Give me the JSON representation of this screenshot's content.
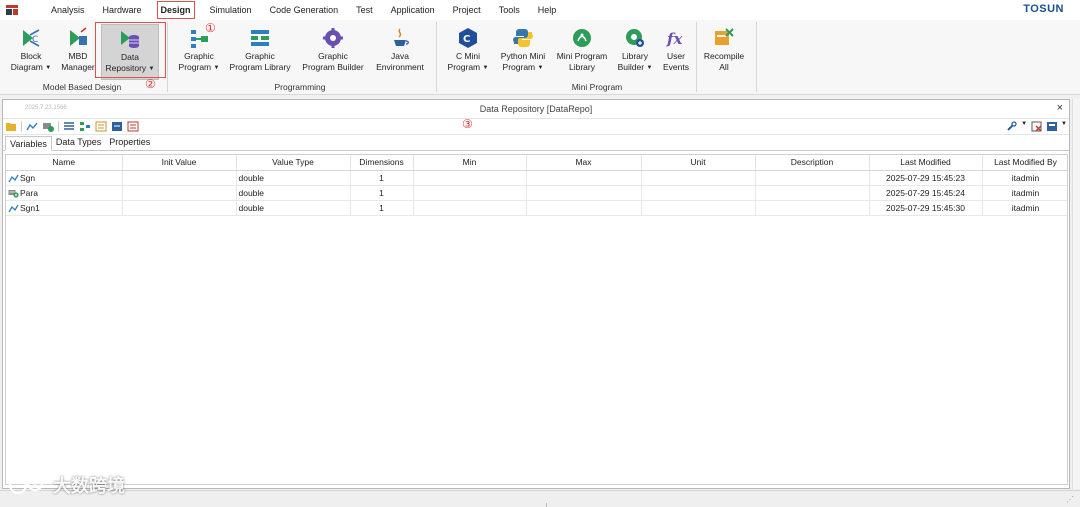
{
  "menu": {
    "items": [
      "Analysis",
      "Hardware",
      "Design",
      "Simulation",
      "Code Generation",
      "Test",
      "Application",
      "Project",
      "Tools",
      "Help"
    ],
    "active": "Design",
    "brand": "TOSUN"
  },
  "ribbon": {
    "buttons": {
      "block_diagram": {
        "line1": "Block",
        "line2": "Diagram"
      },
      "mbd_manager": {
        "line1": "MBD",
        "line2": "Manager"
      },
      "data_repository": {
        "line1": "Data",
        "line2": "Repository"
      },
      "graphic_program": {
        "line1": "Graphic",
        "line2": "Program"
      },
      "graphic_program_library": {
        "line1": "Graphic",
        "line2": "Program Library"
      },
      "graphic_program_builder": {
        "line1": "Graphic",
        "line2": "Program Builder"
      },
      "java_environment": {
        "line1": "Java",
        "line2": "Environment"
      },
      "c_mini_program": {
        "line1": "C Mini",
        "line2": "Program"
      },
      "python_mini_program": {
        "line1": "Python Mini",
        "line2": "Program"
      },
      "mini_program_library": {
        "line1": "Mini Program",
        "line2": "Library"
      },
      "library_builder": {
        "line1": "Library",
        "line2": "Builder"
      },
      "user_events": {
        "line1": "User",
        "line2": "Events"
      },
      "recompile_all": {
        "line1": "Recompile",
        "line2": "All"
      }
    },
    "groups": {
      "model_based_design": "Model Based Design",
      "programming": "Programming",
      "mini_program": "Mini Program"
    },
    "markers": {
      "one": "①",
      "two": "②",
      "three": "③"
    }
  },
  "panel": {
    "faint_label": "2025.7.23.1566",
    "title": "Data Repository [DataRepo]",
    "close": "×",
    "subtabs": [
      "Variables",
      "Data Types",
      "Properties"
    ],
    "active_subtab": "Variables",
    "columns": [
      "Name",
      "Init Value",
      "Value Type",
      "Dimensions",
      "Min",
      "Max",
      "Unit",
      "Description",
      "Last Modified",
      "Last Modified By"
    ],
    "rows": [
      {
        "icon": "signal-icon",
        "name": "Sgn",
        "init": "",
        "type": "double",
        "dims": "1",
        "min": "",
        "max": "",
        "unit": "",
        "desc": "",
        "modified": "2025-07-29 15:45:23",
        "by": "itadmin"
      },
      {
        "icon": "parameter-icon",
        "name": "Para",
        "init": "",
        "type": "double",
        "dims": "1",
        "min": "",
        "max": "",
        "unit": "",
        "desc": "",
        "modified": "2025-07-29 15:45:24",
        "by": "itadmin"
      },
      {
        "icon": "signal-icon",
        "name": "Sgn1",
        "init": "",
        "type": "double",
        "dims": "1",
        "min": "",
        "max": "",
        "unit": "",
        "desc": "",
        "modified": "2025-07-29 15:45:30",
        "by": "itadmin"
      }
    ]
  },
  "watermark": "大数跨境",
  "colors": {
    "accent_red": "#e05050",
    "brand_blue": "#1c4f8f"
  }
}
